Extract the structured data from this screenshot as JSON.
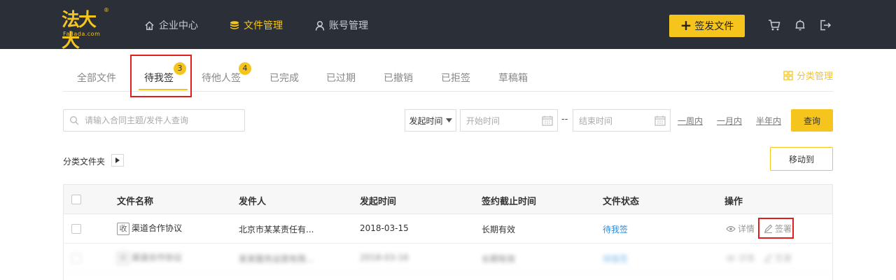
{
  "brand": {
    "logo_text": "法大大",
    "logo_sub": "Fadada.com",
    "logo_mark": "®"
  },
  "nav": {
    "items": [
      {
        "label": "企业中心",
        "icon": "home-icon",
        "active": false
      },
      {
        "label": "文件管理",
        "icon": "coins-icon",
        "active": true
      },
      {
        "label": "账号管理",
        "icon": "user-icon",
        "active": false
      }
    ],
    "send_button": "签发文件"
  },
  "tabs": {
    "items": [
      {
        "label": "全部文件"
      },
      {
        "label": "待我签",
        "badge": "3",
        "active": true
      },
      {
        "label": "待他人签",
        "badge": "4"
      },
      {
        "label": "已完成"
      },
      {
        "label": "已过期"
      },
      {
        "label": "已撤销"
      },
      {
        "label": "已拒签"
      },
      {
        "label": "草稿箱"
      }
    ],
    "category_manage": "分类管理"
  },
  "filters": {
    "search_placeholder": "请输入合同主题/发件人查询",
    "date_type": "发起时间",
    "start_placeholder": "开始时间",
    "separator": "--",
    "end_placeholder": "结束时间",
    "quick_week": "一周内",
    "quick_month": "一月内",
    "quick_halfyear": "半年内",
    "query_button": "查询"
  },
  "folder": {
    "label": "分类文件夹",
    "move_button": "移动到"
  },
  "table": {
    "headers": [
      "文件名称",
      "发件人",
      "发起时间",
      "签约截止时间",
      "文件状态",
      "操作"
    ],
    "rows": [
      {
        "tag": "收",
        "name": "渠道合作协议",
        "sender": "北京市某某责任有...",
        "start": "2018-03-15",
        "deadline": "长期有效",
        "status": "待我签",
        "op_detail": "详情",
        "op_sign": "签署"
      },
      {
        "tag": "收",
        "name": "渠道合作协议",
        "sender": "某某服务运营有限...",
        "start": "2018-03-16",
        "deadline": "长期有效",
        "status": "待我签",
        "op_detail": "详情",
        "op_sign": "签署"
      }
    ]
  },
  "colors": {
    "header_bg": "#2a2f38",
    "accent": "#f5c51e",
    "highlight": "#e01e1e",
    "link": "#2e8bd6"
  }
}
